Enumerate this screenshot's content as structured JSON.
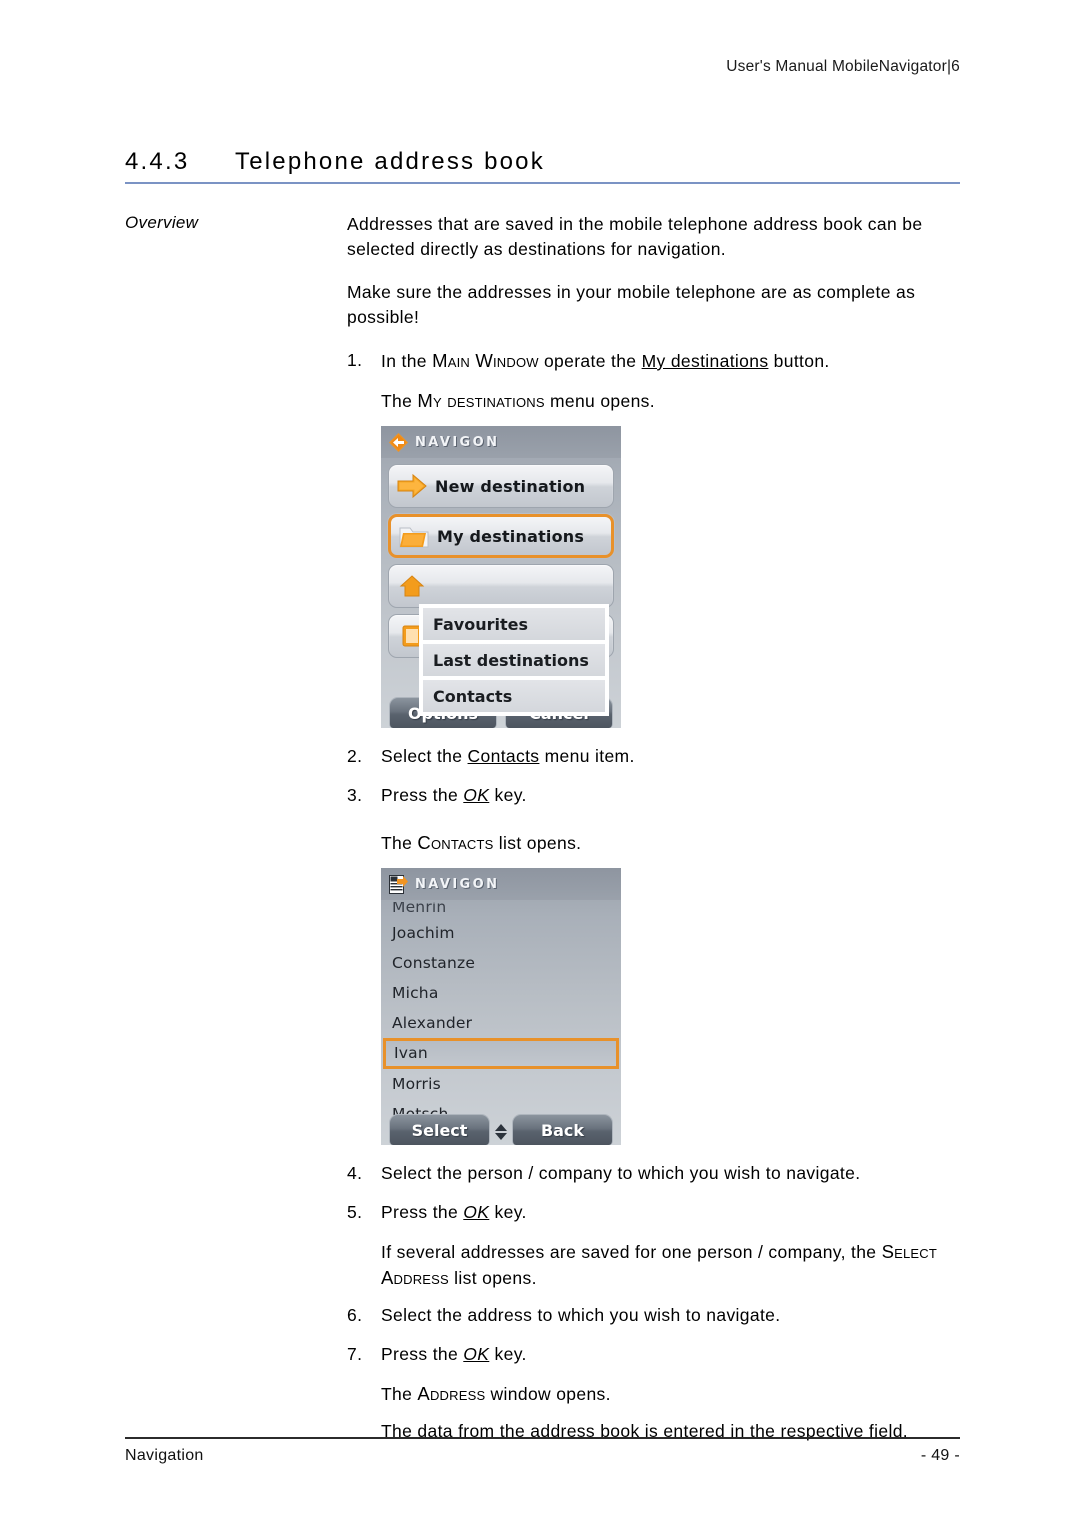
{
  "header": {
    "running_head": "User's Manual MobileNavigator|6"
  },
  "section": {
    "number": "4.4.3",
    "title": "Telephone address book"
  },
  "margin_note": "Overview",
  "overview": {
    "paragraph1": "Addresses that are saved in the mobile telephone address book can be selected directly as destinations for navigation.",
    "paragraph2": "Make sure the addresses in your mobile telephone are as complete as possible!"
  },
  "steps": {
    "s1_num": "1.",
    "s1_pre": "In the ",
    "s1_sc1": "Main Window",
    "s1_mid": " operate the ",
    "s1_link": "My destinations",
    "s1_post": " button.",
    "s1_result_pre": "The ",
    "s1_result_sc": "My destinations",
    "s1_result_post": " menu opens.",
    "s2_num": "2.",
    "s2_pre": "Select the ",
    "s2_link": "Contacts",
    "s2_post": " menu item.",
    "s3_num": "3.",
    "s3_pre": "Press the ",
    "s3_key": "OK",
    "s3_post": " key.",
    "s3_result_pre": "The ",
    "s3_result_sc": "Contacts",
    "s3_result_post": " list opens.",
    "s4_num": "4.",
    "s4_text": "Select the person / company to which you wish to navigate.",
    "s5_num": "5.",
    "s5_pre": "Press the ",
    "s5_key": "OK",
    "s5_post": " key.",
    "s5_result_pre": "If several addresses are saved for one person / company, the ",
    "s5_result_sc": "Select Address",
    "s5_result_post": " list opens.",
    "s6_num": "6.",
    "s6_text": "Select the address to which you wish to navigate.",
    "s7_num": "7.",
    "s7_pre": "Press the ",
    "s7_key": "OK",
    "s7_post": " key.",
    "s7_result_pre": "The ",
    "s7_result_sc": "Address",
    "s7_result_post": " window opens.",
    "s7_result2": "The data from the address book is entered in the respective field."
  },
  "device_menu": {
    "brand": "NAVIGON",
    "buttons": [
      {
        "label": "New destination",
        "icon": "arrow-right-icon",
        "selected": false
      },
      {
        "label": "My destinations",
        "icon": "folder-icon",
        "selected": true
      },
      {
        "label": "",
        "icon": "home-icon",
        "selected": false
      },
      {
        "label": "",
        "icon": "book-icon",
        "selected": false
      }
    ],
    "submenu": [
      {
        "label": "Favourites"
      },
      {
        "label": "Last destinations"
      },
      {
        "label": "Contacts"
      }
    ],
    "softkeys": [
      {
        "label": "Options"
      },
      {
        "label": "Cancel"
      }
    ],
    "accent_color": "#e8912a"
  },
  "device_contacts": {
    "brand": "NAVIGON",
    "status_icon": "sim-card-icon",
    "items": [
      {
        "name": "Menrin",
        "selected": false,
        "clipped": true
      },
      {
        "name": "Joachim",
        "selected": false
      },
      {
        "name": "Constanze",
        "selected": false
      },
      {
        "name": "Micha",
        "selected": false
      },
      {
        "name": "Alexander",
        "selected": false
      },
      {
        "name": "Ivan",
        "selected": true
      },
      {
        "name": "Morris",
        "selected": false
      },
      {
        "name": "Motsch",
        "selected": false
      }
    ],
    "softkeys": [
      {
        "label": "Select"
      },
      {
        "label": "Back"
      }
    ],
    "scroll_indicator": "updown-arrows-icon",
    "accent_color": "#e8912a"
  },
  "footer": {
    "chapter": "Navigation",
    "page": "- 49 -"
  }
}
